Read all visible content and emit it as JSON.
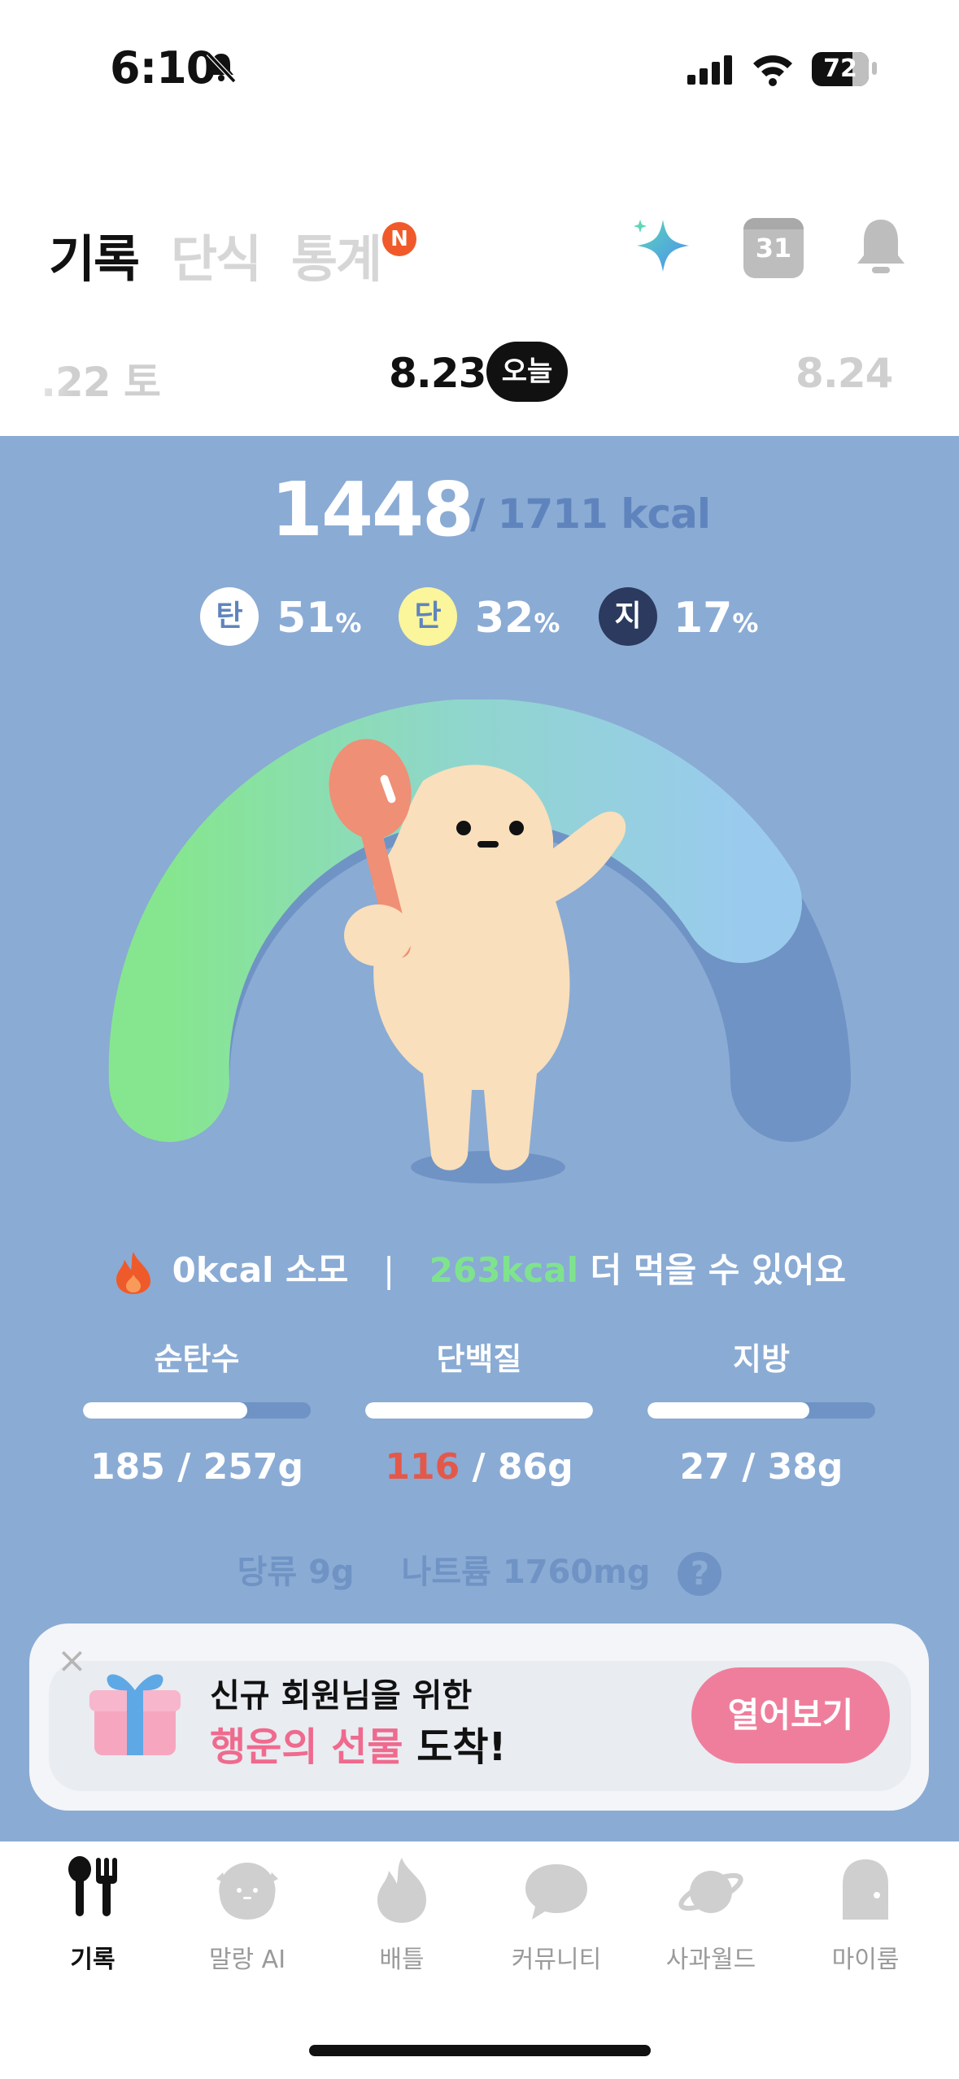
{
  "status_bar": {
    "time": "6:10",
    "battery": "72"
  },
  "header": {
    "tabs": [
      {
        "label": "기록",
        "active": true
      },
      {
        "label": "단식",
        "active": false
      },
      {
        "label": "통계",
        "active": false,
        "badge": "N"
      }
    ],
    "icons": [
      "sparkle-icon",
      "calendar-icon",
      "bell-icon"
    ],
    "calendar_day": "31"
  },
  "date_strip": {
    "prev": ".22 토",
    "current": "8.23",
    "today_label": "오늘",
    "next": "8.24"
  },
  "summary": {
    "kcal_eaten": "1448",
    "kcal_goal": "/ 1711 kcal",
    "macros": [
      {
        "letter": "탄",
        "value": "51",
        "unit": "%",
        "color": "#ffffff",
        "text_color": "#5f84bd"
      },
      {
        "letter": "단",
        "value": "32",
        "unit": "%",
        "color": "#fbf59c",
        "text_color": "#5f84bd"
      },
      {
        "letter": "지",
        "value": "17",
        "unit": "%",
        "color": "#2b3a5e",
        "text_color": "#ffffff"
      }
    ]
  },
  "burn": {
    "burned": "0kcal 소모",
    "separator": "|",
    "remaining": "263kcal",
    "remaining_text": "더 먹을 수 있어요"
  },
  "nutrients": [
    {
      "label": "순탄수",
      "current": "185",
      "goal": "/ 257g",
      "progress": 0.72,
      "over": false
    },
    {
      "label": "단백질",
      "current": "116",
      "goal": "/ 86g",
      "progress": 1.0,
      "over": true
    },
    {
      "label": "지방",
      "current": "27",
      "goal": "/ 38g",
      "progress": 0.71,
      "over": false
    }
  ],
  "sub_nutrients": {
    "sugar": "당류 9g",
    "sodium": "나트륨 1760mg",
    "help": "?"
  },
  "promo": {
    "line1": "신규 회원님을 위한",
    "line2_highlight": "행운의 선물",
    "line2_rest": " 도착!",
    "button": "열어보기",
    "close": "×"
  },
  "bottom_nav": [
    {
      "label": "기록",
      "active": true
    },
    {
      "label": "말랑 AI",
      "active": false
    },
    {
      "label": "배틀",
      "active": false
    },
    {
      "label": "커뮤니티",
      "active": false
    },
    {
      "label": "사과월드",
      "active": false
    },
    {
      "label": "마이룸",
      "active": false
    }
  ],
  "colors": {
    "panel": "#8aabd4",
    "accent_green": "#7fe38e",
    "over_red": "#e4584a",
    "promo_pink": "#ef7e9c",
    "badge_orange": "#f05a2a"
  }
}
